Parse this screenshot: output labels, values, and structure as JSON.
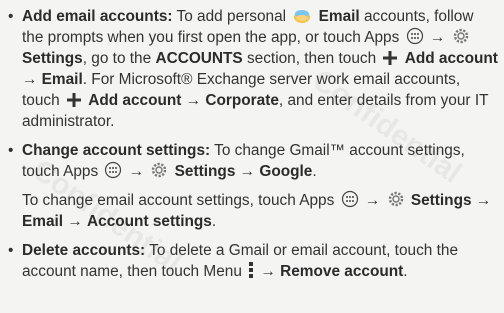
{
  "colors": {
    "text": "#333333",
    "bold": "#2b2b2b",
    "background": "#f4f4f3"
  },
  "watermark": {
    "text": "Confidential"
  },
  "items": [
    {
      "title": "Add email accounts:",
      "t1": "To add personal",
      "email_app": "Email",
      "t2": "accounts, follow the prompts when you first open the app, or touch Apps",
      "arrow1": "→",
      "settings": "Settings",
      "t3": ", go to the",
      "accounts": "ACCOUNTS",
      "t4": "section, then touch",
      "add_account": "Add account",
      "arrow2": "→",
      "email": "Email",
      "t5": ". For Microsoft® Exchange server work email accounts, touch",
      "add_account2": "Add account",
      "arrow3": "→",
      "corporate": "Corporate",
      "t6": ", and enter details from your IT administrator."
    },
    {
      "title": "Change account settings:",
      "t1": "To change Gmail™ account settings, touch Apps",
      "arrow1": "→",
      "settings": "Settings",
      "arrow2": "→",
      "google": "Google",
      "end": "."
    },
    {
      "t1": "To change email account settings, touch Apps",
      "arrow1": "→",
      "settings": "Settings",
      "arrow2": "→",
      "email": "Email",
      "arrow3": "→",
      "account_settings": "Account settings",
      "end": "."
    },
    {
      "title": "Delete accounts:",
      "t1": "To delete a Gmail or email account, touch the account name, then touch Menu",
      "arrow1": "→",
      "remove": "Remove account",
      "end": "."
    }
  ],
  "bullet": "•",
  "icons": [
    "email-app-icon",
    "apps-icon",
    "settings-gear-icon",
    "plus-icon",
    "menu-dots-icon"
  ]
}
